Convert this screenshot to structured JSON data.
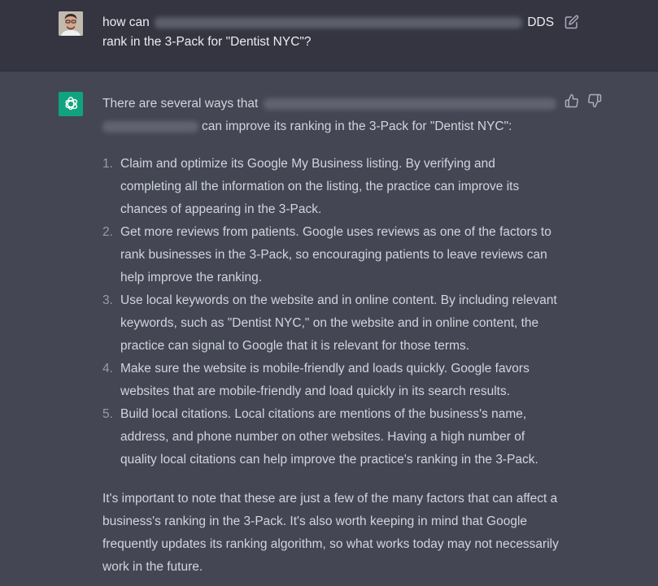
{
  "user_message": {
    "prefix": "how can",
    "suffix": "DDS",
    "line2": "rank in the 3-Pack for \"Dentist NYC\"?"
  },
  "assistant_message": {
    "intro_prefix": "There are several ways that",
    "intro_suffix": "can improve its ranking in the 3-Pack for \"Dentist NYC\":",
    "points": [
      {
        "num": "1.",
        "text": "Claim and optimize its Google My Business listing. By verifying and completing all the information on the listing, the practice can improve its chances of appearing in the 3-Pack."
      },
      {
        "num": "2.",
        "text": "Get more reviews from patients. Google uses reviews as one of the factors to rank businesses in the 3-Pack, so encouraging patients to leave reviews can help improve the ranking."
      },
      {
        "num": "3.",
        "text": "Use local keywords on the website and in online content. By including relevant keywords, such as \"Dentist NYC,\" on the website and in online content, the practice can signal to Google that it is relevant for those terms."
      },
      {
        "num": "4.",
        "text": "Make sure the website is mobile-friendly and loads quickly. Google favors websites that are mobile-friendly and load quickly in its search results."
      },
      {
        "num": "5.",
        "text": "Build local citations. Local citations are mentions of the business's name, address, and phone number on other websites. Having a high number of quality local citations can help improve the practice's ranking in the 3-Pack."
      }
    ],
    "closing": "It's important to note that these are just a few of the many factors that can affect a business's ranking in the 3-Pack. It's also worth keeping in mind that Google frequently updates its ranking algorithm, so what works today may not necessarily work in the future."
  },
  "icons": {
    "edit": "edit-icon",
    "thumbs_up": "thumbs-up-icon",
    "thumbs_down": "thumbs-down-icon",
    "assistant_logo": "openai-logo-icon"
  },
  "colors": {
    "user_bg": "#343541",
    "assistant_bg": "#444654",
    "logo_bg": "#10a37f"
  }
}
